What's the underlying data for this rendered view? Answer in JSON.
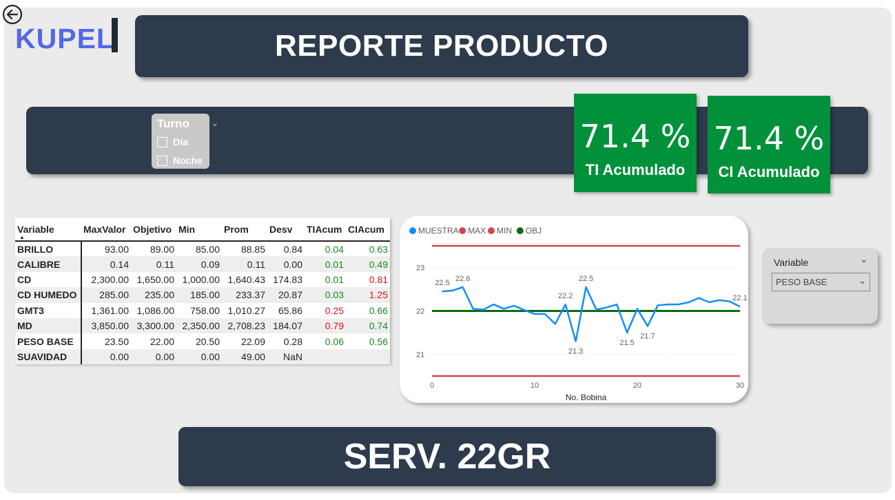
{
  "header": {
    "title": "REPORTE PRODUCTO",
    "logo": "KUPEL",
    "back_icon": "back-arrow-icon"
  },
  "turno": {
    "title": "Turno",
    "options": [
      "Día",
      "Noche"
    ]
  },
  "kpis": [
    {
      "value": "71.4 %",
      "label": "TI Acumulado"
    },
    {
      "value": "71.4 %",
      "label": "CI Acumulado"
    }
  ],
  "table": {
    "columns": [
      "Variable",
      "MaxValor",
      "Objetivo",
      "Min",
      "Prom",
      "Desv",
      "TIAcum",
      "CIAcum"
    ],
    "rows": [
      [
        "BRILLO",
        "93.00",
        "89.00",
        "85.00",
        "88.85",
        "0.84",
        "0.04",
        "0.63"
      ],
      [
        "CALIBRE",
        "0.14",
        "0.11",
        "0.09",
        "0.11",
        "0.00",
        "0.01",
        "0.49"
      ],
      [
        "CD",
        "2,300.00",
        "1,650.00",
        "1,000.00",
        "1,640.43",
        "174.83",
        "0.01",
        "0.81"
      ],
      [
        "CD HUMEDO",
        "285.00",
        "235.00",
        "185.00",
        "233.37",
        "20.87",
        "0.03",
        "1.25"
      ],
      [
        "GMT3",
        "1,361.00",
        "1,086.00",
        "758.00",
        "1,010.27",
        "65.86",
        "0.25",
        "0.66"
      ],
      [
        "MD",
        "3,850.00",
        "3,300.00",
        "2,350.00",
        "2,708.23",
        "184.07",
        "0.79",
        "0.74"
      ],
      [
        "PESO BASE",
        "23.50",
        "22.00",
        "20.50",
        "22.09",
        "0.28",
        "0.06",
        "0.56"
      ],
      [
        "SUAVIDAD",
        "0.00",
        "0.00",
        "0.00",
        "49.00",
        "NaN",
        "",
        ""
      ]
    ],
    "ti_colors": [
      "green",
      "green",
      "green",
      "green",
      "red",
      "red",
      "green",
      ""
    ],
    "ci_colors": [
      "green",
      "green",
      "red",
      "red",
      "green",
      "green",
      "green",
      ""
    ]
  },
  "chart_data": {
    "type": "line",
    "xlabel": "No. Bobina",
    "ylabel": "",
    "xlim": [
      0,
      30
    ],
    "ylim": [
      20.5,
      23.5
    ],
    "xticks": [
      "0",
      "10",
      "20",
      "30"
    ],
    "yticks": [
      "21",
      "22",
      "23"
    ],
    "legend_position": "top-left",
    "series": [
      {
        "name": "MUESTRA",
        "color": "#118dff",
        "x": [
          1,
          2,
          3,
          4,
          5,
          6,
          7,
          8,
          9,
          10,
          11,
          12,
          13,
          14,
          15,
          16,
          17,
          18,
          19,
          20,
          21,
          22,
          23,
          24,
          25,
          26,
          27,
          28,
          29,
          30
        ],
        "y": [
          22.45,
          22.47,
          22.55,
          22.05,
          22.03,
          22.15,
          22.05,
          22.12,
          22.02,
          21.93,
          21.93,
          21.7,
          22.15,
          21.3,
          22.55,
          22.03,
          22.08,
          22.15,
          21.5,
          22.05,
          21.65,
          22.13,
          22.15,
          22.15,
          22.2,
          22.3,
          22.2,
          22.25,
          22.22,
          22.1
        ]
      },
      {
        "name": "MAX",
        "color": "#d64550",
        "x": [
          0,
          30
        ],
        "y": [
          23.5,
          23.5
        ]
      },
      {
        "name": "MIN",
        "color": "#d64550",
        "x": [
          0,
          30
        ],
        "y": [
          20.5,
          20.5
        ]
      },
      {
        "name": "OBJ",
        "color": "#0b6b0b",
        "x": [
          0,
          30
        ],
        "y": [
          22.0,
          22.0
        ]
      }
    ],
    "data_labels": [
      {
        "x": 1,
        "y": 22.45,
        "text": "22.5"
      },
      {
        "x": 3,
        "y": 22.55,
        "text": "22.6"
      },
      {
        "x": 13,
        "y": 22.15,
        "text": "22.2"
      },
      {
        "x": 14,
        "y": 21.3,
        "text": "21.3"
      },
      {
        "x": 15,
        "y": 22.55,
        "text": "22.5"
      },
      {
        "x": 19,
        "y": 21.5,
        "text": "21.5"
      },
      {
        "x": 21,
        "y": 21.65,
        "text": "21.7"
      },
      {
        "x": 30,
        "y": 22.1,
        "text": "22.1"
      }
    ]
  },
  "variable_slicer": {
    "title": "Variable",
    "selected": "PESO BASE"
  },
  "footer": {
    "title": "SERV. 22GR"
  }
}
